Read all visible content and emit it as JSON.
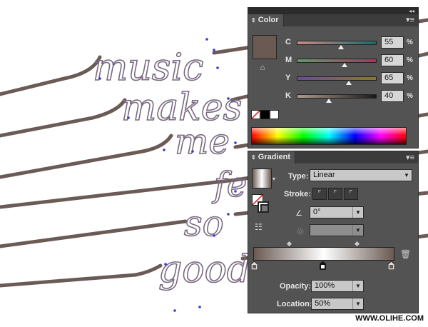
{
  "artwork": {
    "words": [
      "music",
      "makes",
      "me",
      "feel",
      "so",
      "good"
    ]
  },
  "color_panel": {
    "tab_label": "Color",
    "menu_icon": "panel-menu-icon",
    "fill_color": "#6a5a52",
    "channels": [
      {
        "label": "C",
        "value": "55",
        "unit": "%",
        "level": 0.55,
        "track_from": "#c98a87",
        "track_to": "#1a6a6a"
      },
      {
        "label": "M",
        "value": "60",
        "unit": "%",
        "level": 0.6,
        "track_from": "#5f9a6e",
        "track_to": "#a0385e"
      },
      {
        "label": "Y",
        "value": "65",
        "unit": "%",
        "level": 0.65,
        "track_from": "#6a4a9a",
        "track_to": "#8a7a2a"
      },
      {
        "label": "K",
        "value": "40",
        "unit": "%",
        "level": 0.4,
        "track_from": "#b09a92",
        "track_to": "#1a1a1a"
      }
    ]
  },
  "gradient_panel": {
    "tab_label": "Gradient",
    "menu_icon": "panel-menu-icon",
    "type_label": "Type:",
    "type_value": "Linear",
    "stroke_label": "Stroke:",
    "angle_value": "0°",
    "aspect_value": "",
    "start_color": "#6a5a52",
    "mid_color": "#ffffff",
    "end_color": "#6a5a52",
    "opacity_label": "Opacity:",
    "opacity_value": "100%",
    "location_label": "Location:",
    "location_value": "50%"
  },
  "watermark": "WWW.OLIHE.COM"
}
